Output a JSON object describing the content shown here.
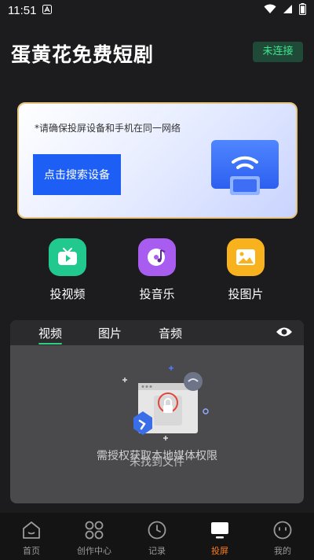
{
  "status_bar": {
    "time": "11:51",
    "icons": [
      "notification-a-icon",
      "wifi-icon",
      "signal-icon",
      "battery-icon"
    ]
  },
  "header": {
    "title": "蛋黄花免费短剧",
    "connection_status": "未连接"
  },
  "cast_card": {
    "hint": "*请确保投屏设备和手机在同一网络",
    "search_button": "点击搜索设备",
    "illustration": "wireless-screen-icon"
  },
  "features": [
    {
      "label": "投视频",
      "icon": "tv-icon",
      "color": "#22c98f"
    },
    {
      "label": "投音乐",
      "icon": "music-disc-icon",
      "color": "#a85cf0"
    },
    {
      "label": "投图片",
      "icon": "image-icon",
      "color": "#f7b21d"
    }
  ],
  "media": {
    "tabs": [
      "视频",
      "图片",
      "音频"
    ],
    "active_tab": "视频",
    "permission_text": "需授权获取本地媒体权限",
    "empty_text": "未找到文件"
  },
  "bottom_nav": [
    {
      "label": "首页",
      "icon": "home-icon"
    },
    {
      "label": "创作中心",
      "icon": "create-center-icon"
    },
    {
      "label": "记录",
      "icon": "history-icon"
    },
    {
      "label": "投屏",
      "icon": "screen-cast-icon",
      "active": true
    },
    {
      "label": "我的",
      "icon": "profile-icon"
    }
  ],
  "colors": {
    "background": "#1c1c1e",
    "accent_green": "#3ee58e",
    "button_blue": "#1d5ff5",
    "nav_active": "#ff7a1a"
  }
}
